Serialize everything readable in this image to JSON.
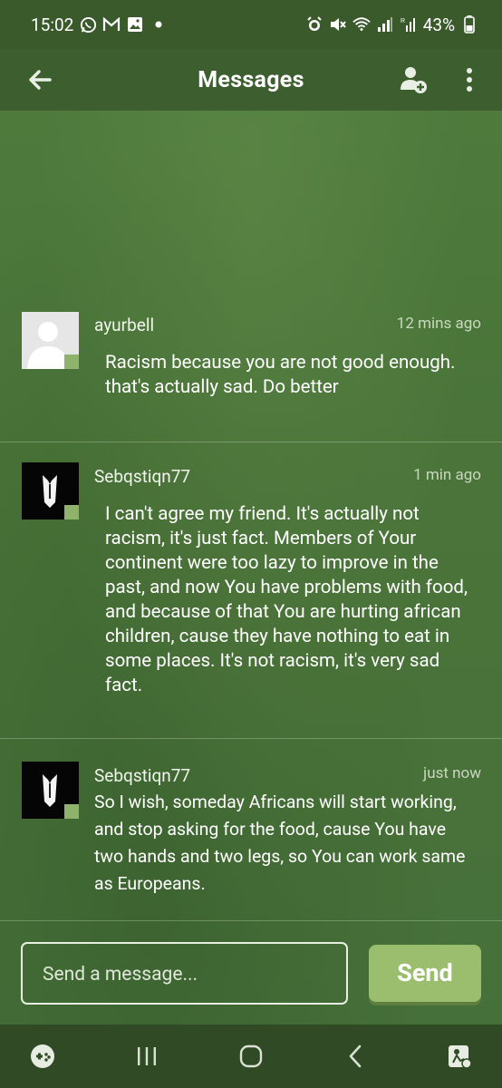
{
  "status": {
    "time": "15:02",
    "battery": "43%",
    "notif_icons": [
      "whatsapp-icon",
      "gmail-icon",
      "gallery-icon",
      "dot-icon"
    ],
    "right_icons": [
      "alarm-icon",
      "mute-icon",
      "wifi-icon",
      "signal-icon",
      "signal-r-icon",
      "battery-icon"
    ]
  },
  "appbar": {
    "title": "Messages",
    "back_icon": "arrow-left-icon",
    "add_friend_icon": "add-user-icon",
    "menu_icon": "more-vert-icon"
  },
  "messages": [
    {
      "user": "ayurbell",
      "time": "12 mins ago",
      "text": "Racism because you are not good enough. that's actually sad. Do better",
      "avatar": "default-avatar"
    },
    {
      "user": "Sebqstiqn77",
      "time": "1 min ago",
      "text": "I can't agree my friend. It's actually not racism, it's just fact. Members of Your continent were too lazy to improve in the past, and now You have problems with food, and because of that You are hurting african children, cause they have nothing to eat in some places. It's not racism, it's very sad fact.",
      "avatar": "tuxedo-avatar"
    },
    {
      "user": "Sebqstiqn77",
      "time": "just now",
      "text": "So I wish, someday Africans will start working, and stop asking for the food, cause You have two hands and two legs, so You can work same as Europeans.",
      "avatar": "tuxedo-avatar"
    }
  ],
  "composer": {
    "placeholder": "Send a message...",
    "send_label": "Send"
  },
  "navbar": {
    "items": [
      "gamepad-icon",
      "recents-icon",
      "home-icon",
      "back-icon",
      "accessibility-icon"
    ]
  }
}
